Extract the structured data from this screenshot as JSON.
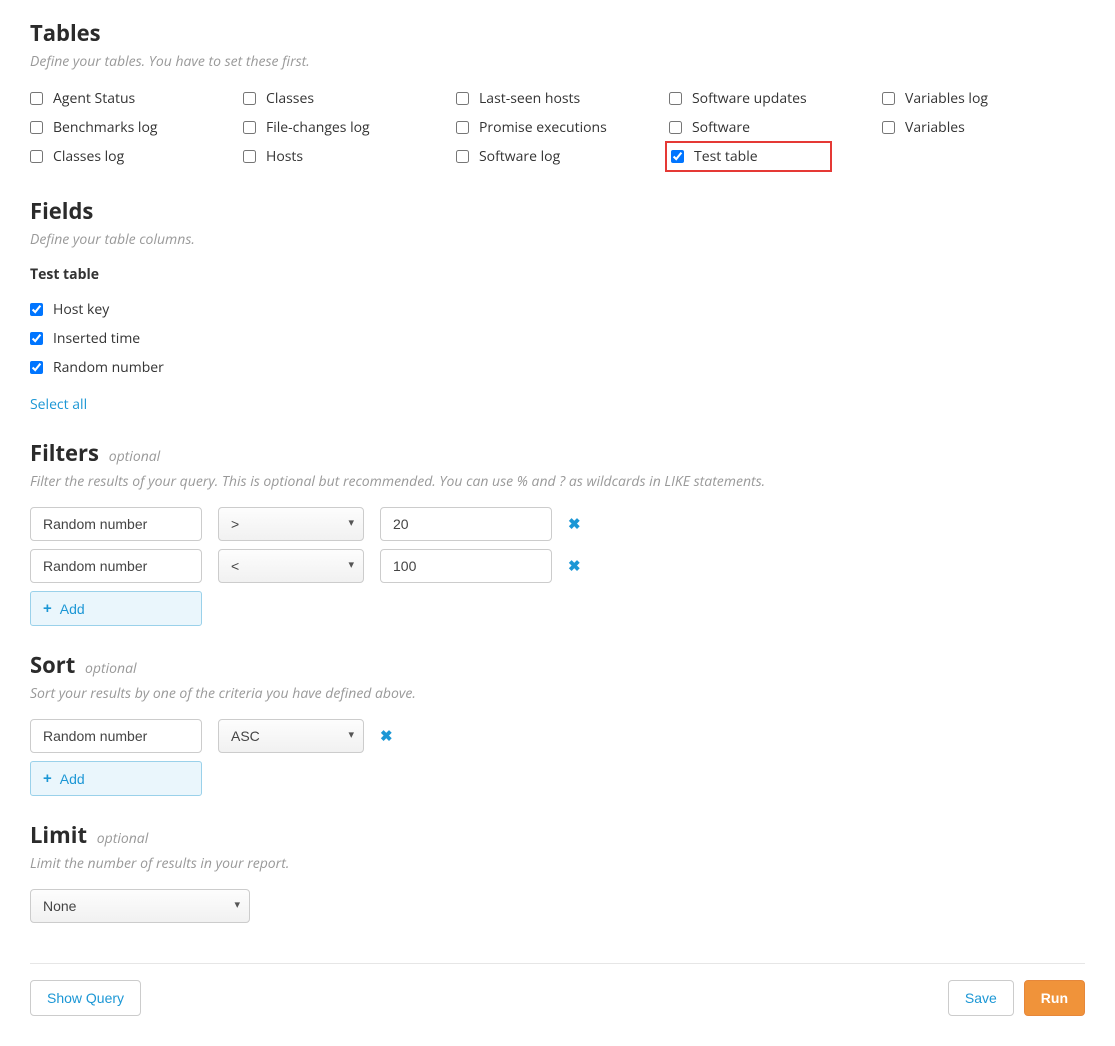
{
  "tables": {
    "title": "Tables",
    "subtitle": "Define your tables. You have to set these first.",
    "items": [
      {
        "label": "Agent Status",
        "checked": false
      },
      {
        "label": "Benchmarks log",
        "checked": false
      },
      {
        "label": "Classes log",
        "checked": false
      },
      {
        "label": "Classes",
        "checked": false
      },
      {
        "label": "File-changes log",
        "checked": false
      },
      {
        "label": "Hosts",
        "checked": false
      },
      {
        "label": "Last-seen hosts",
        "checked": false
      },
      {
        "label": "Promise executions",
        "checked": false
      },
      {
        "label": "Software log",
        "checked": false
      },
      {
        "label": "Software updates",
        "checked": false
      },
      {
        "label": "Software",
        "checked": false
      },
      {
        "label": "Test table",
        "checked": true,
        "highlight": true
      },
      {
        "label": "Variables log",
        "checked": false
      },
      {
        "label": "Variables",
        "checked": false
      }
    ]
  },
  "fields": {
    "title": "Fields",
    "subtitle": "Define your table columns.",
    "group_title": "Test table",
    "items": [
      {
        "label": "Host key",
        "checked": true
      },
      {
        "label": "Inserted time",
        "checked": true
      },
      {
        "label": "Random number",
        "checked": true
      }
    ],
    "select_all": "Select all"
  },
  "filters": {
    "title": "Filters",
    "optional": "optional",
    "subtitle": "Filter the results of your query. This is optional but recommended. You can use % and ? as wildcards in LIKE statements.",
    "rows": [
      {
        "field": "Random number",
        "op": ">",
        "value": "20"
      },
      {
        "field": "Random number",
        "op": "<",
        "value": "100"
      }
    ],
    "add_label": "Add"
  },
  "sort": {
    "title": "Sort",
    "optional": "optional",
    "subtitle": "Sort your results by one of the criteria you have defined above.",
    "rows": [
      {
        "field": "Random number",
        "dir": "ASC"
      }
    ],
    "add_label": "Add"
  },
  "limit": {
    "title": "Limit",
    "optional": "optional",
    "subtitle": "Limit the number of results in your report.",
    "value": "None"
  },
  "footer": {
    "show_query": "Show Query",
    "save": "Save",
    "run": "Run"
  }
}
